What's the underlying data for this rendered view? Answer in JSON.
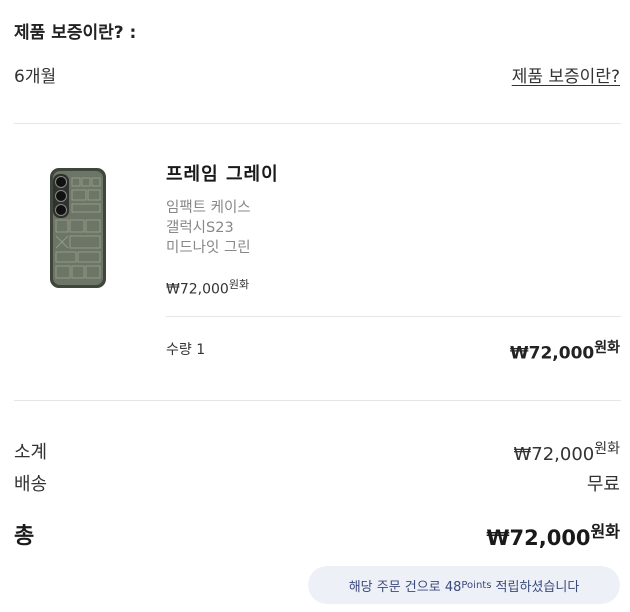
{
  "warranty": {
    "title": "제품 보증이란? :",
    "period": "6개월",
    "link_label": "제품 보증이란?"
  },
  "product": {
    "name": "프레임 그레이",
    "variants": [
      "임팩트 케이스",
      "갤럭시S23",
      "미드나잇 그린"
    ],
    "price": "₩72,000",
    "price_unit": "원화",
    "quantity_label": "수량 1",
    "line_total": "₩72,000",
    "line_total_unit": "원화",
    "image_icon": "phone-case-image"
  },
  "summary": {
    "subtotal_label": "소계",
    "subtotal_value": "₩72,000",
    "subtotal_unit": "원화",
    "shipping_label": "배송",
    "shipping_value": "무료",
    "total_label": "총",
    "total_value": "₩72,000",
    "total_unit": "원화"
  },
  "points": {
    "prefix": "해당 주문 건으로 48",
    "superscript": "Points",
    "suffix": " 적립하셨습니다"
  },
  "colors": {
    "badge_bg": "#eef0f8",
    "badge_text": "#3b4a7a",
    "case_body": "#4a5244"
  }
}
